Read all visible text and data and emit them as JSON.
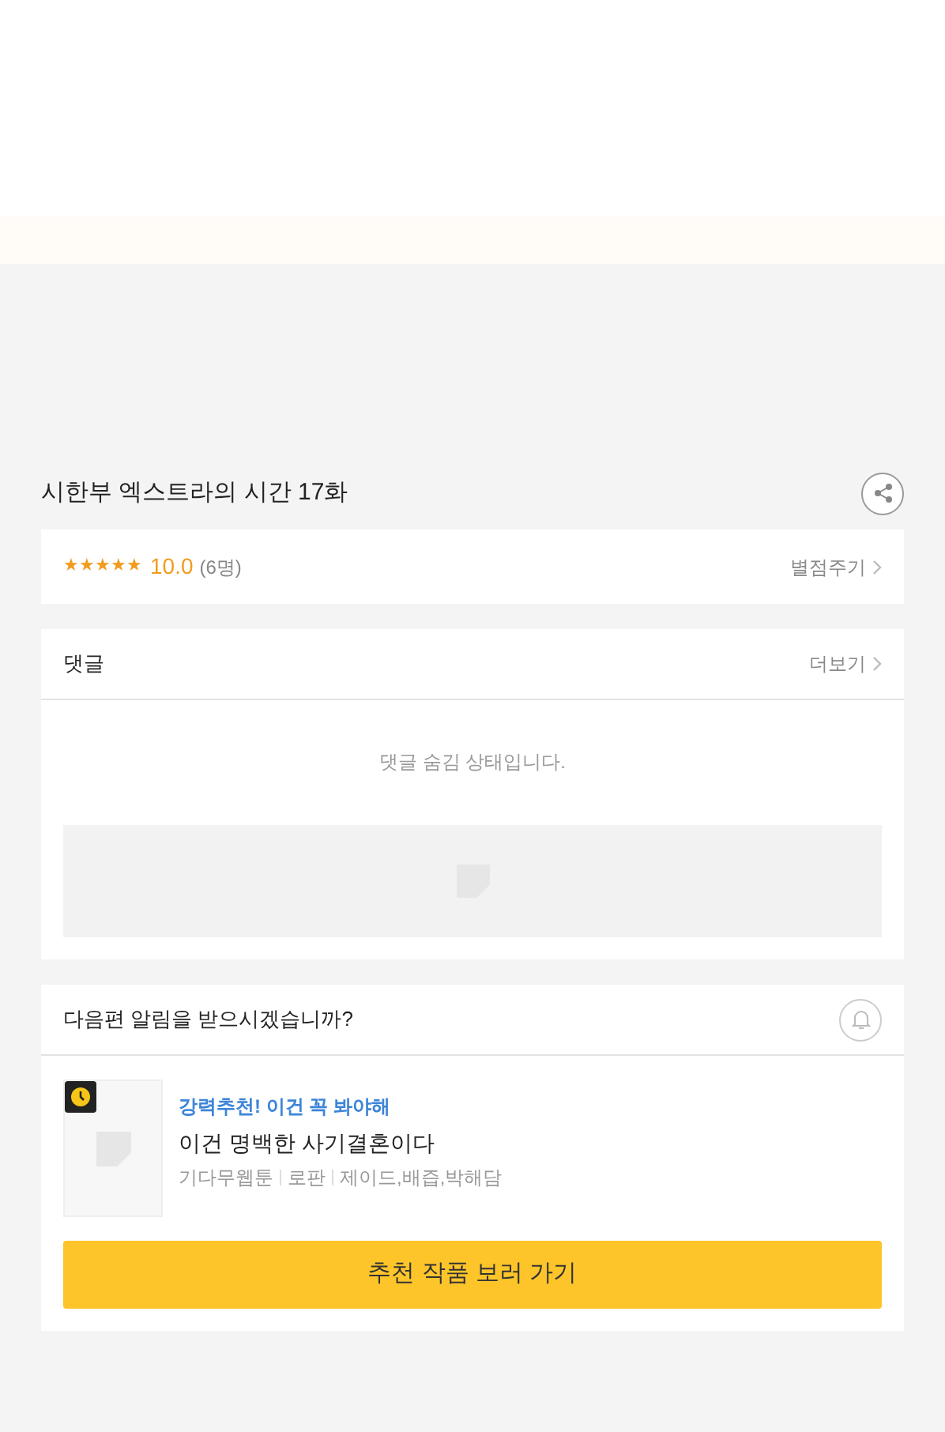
{
  "episode": {
    "title": "시한부 엑스트라의 시간 17화"
  },
  "rating": {
    "stars": 5,
    "score": "10.0",
    "count": "(6명)",
    "action": "별점주기"
  },
  "comments": {
    "title": "댓글",
    "more": "더보기",
    "notice": "댓글 숨김 상태입니다."
  },
  "notify": {
    "question": "다음편 알림을 받으시겠습니까?"
  },
  "recommendation": {
    "tag": "강력추천! 이건 꼭 봐야해",
    "title": "이건 명백한 사기결혼이다",
    "meta": [
      "기다무웹툰",
      "로판",
      "제이드,배즙,박해담"
    ],
    "button": "추천 작품 보러 가기"
  }
}
